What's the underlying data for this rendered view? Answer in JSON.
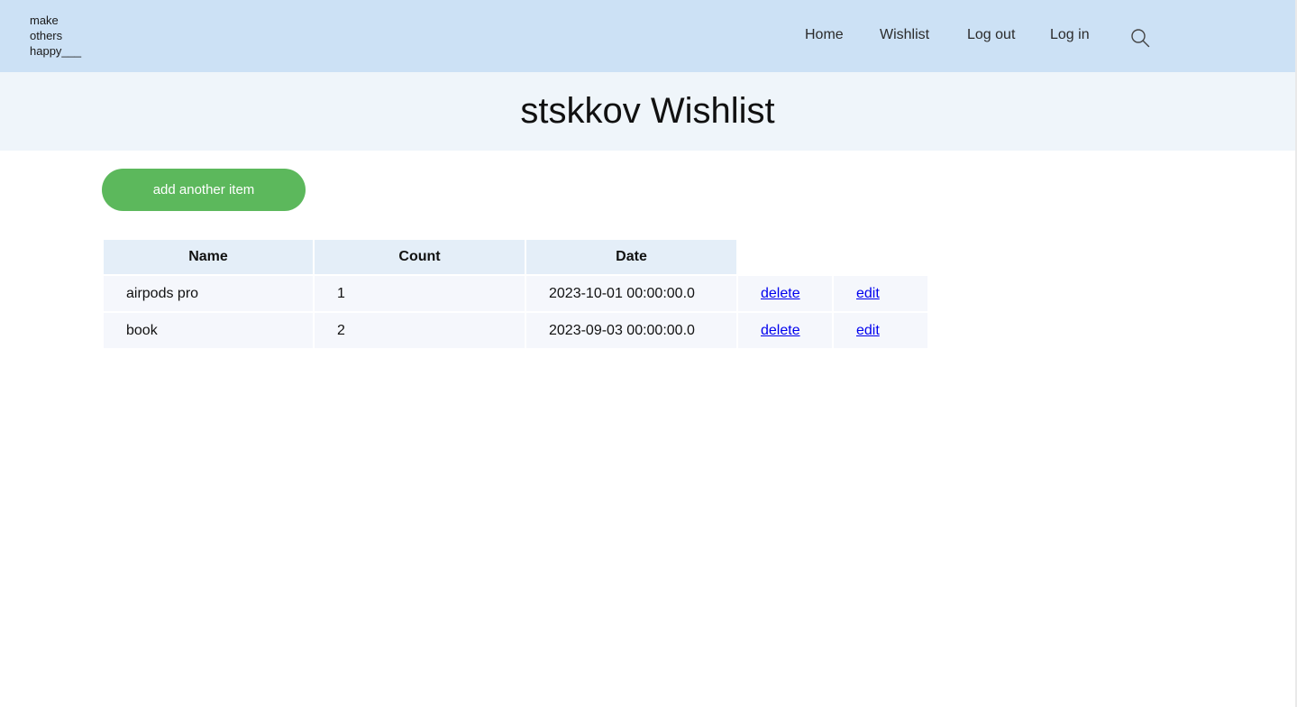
{
  "logo": {
    "line1": "make",
    "line2": "others",
    "line3": "happy___"
  },
  "nav": {
    "items": [
      {
        "label": "Home"
      },
      {
        "label": "Wishlist"
      },
      {
        "label": "Log out"
      },
      {
        "label": "Log in"
      }
    ],
    "search_icon": "search-icon"
  },
  "page": {
    "title": "stskkov Wishlist"
  },
  "actions": {
    "add_label": "add another item"
  },
  "table": {
    "headers": {
      "name": "Name",
      "count": "Count",
      "date": "Date"
    },
    "rows": [
      {
        "name": "airpods pro",
        "count": "1",
        "date": "2023-10-01 00:00:00.0",
        "delete": "delete",
        "edit": "edit"
      },
      {
        "name": "book",
        "count": "2",
        "date": "2023-09-03 00:00:00.0",
        "delete": "delete",
        "edit": "edit"
      }
    ]
  },
  "colors": {
    "navbar": "#cce1f5",
    "title_band": "#eff5fa",
    "button": "#5cb85c",
    "header_cell": "#e4eef8",
    "body_cell": "#f5f7fc",
    "link": "#0000ee"
  }
}
